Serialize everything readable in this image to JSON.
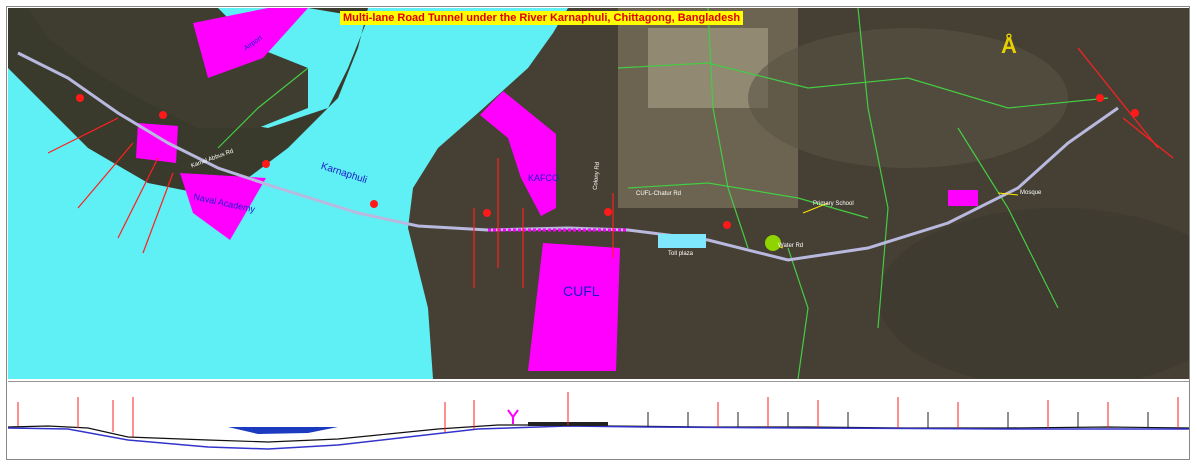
{
  "title": "Multi-lane Road Tunnel under the River Karnaphuli, Chittagong, Bangladesh",
  "labels": {
    "river": "Karnaphuli",
    "naval_academy": "Naval Academy",
    "kafco": "KAFCO",
    "cufl": "CUFL",
    "airport_zone": "Airport",
    "road_kafco": "Colony Rd",
    "road_cufl": "CUFL-Chatur Rd",
    "road_naval": "Kamal Abbus Rd",
    "toll": "Toll plaza",
    "mosque": "Mosque",
    "school": "Primary School",
    "pond": "Water Rd"
  },
  "icons": {
    "north_arrow": "north-arrow-icon",
    "tunnel_marker": "tunnel-marker-icon"
  },
  "colors": {
    "river": "#5ff0f5",
    "industrial_zone": "#ff00ff",
    "alignment": "#b9b9e0",
    "markers": "#ff0000",
    "roads": "#44cc44"
  }
}
